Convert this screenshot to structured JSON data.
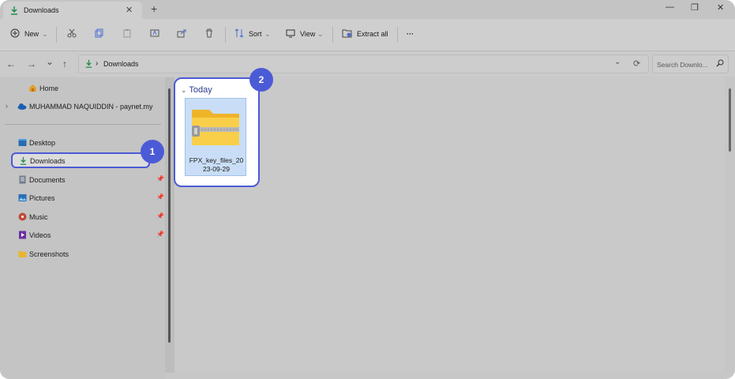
{
  "window": {
    "tab_title": "Downloads",
    "tab_close": "✕",
    "new_tab": "+",
    "minimize": "—",
    "maximize": "❐",
    "close": "✕"
  },
  "toolbar": {
    "new_label": "New",
    "sort_label": "Sort",
    "view_label": "View",
    "extract_label": "Extract all",
    "more_label": "···"
  },
  "address": {
    "back": "←",
    "forward": "→",
    "recent": "⌄",
    "up": "↑",
    "separator": "›",
    "current_folder": "Downloads",
    "search_placeholder": "Search Downlo..."
  },
  "sidebar": {
    "home": "Home",
    "onedrive": "MUHAMMAD NAQUIDDIN - paynet.my",
    "items": [
      {
        "label": "Desktop",
        "pinned": true
      },
      {
        "label": "Downloads",
        "pinned": true,
        "selected": true
      },
      {
        "label": "Documents",
        "pinned": true
      },
      {
        "label": "Pictures",
        "pinned": true
      },
      {
        "label": "Music",
        "pinned": true
      },
      {
        "label": "Videos",
        "pinned": true
      },
      {
        "label": "Screenshots",
        "pinned": false
      }
    ]
  },
  "content": {
    "group_label": "Today",
    "file_name_line1": "FPX_key_files_20",
    "file_name_line2": "23-09-29"
  },
  "annotations": {
    "step1": "1",
    "step2": "2"
  },
  "colors": {
    "accent": "#4b5bd6",
    "download_green": "#1e8a4c",
    "folder_yellow": "#f7c23b"
  }
}
